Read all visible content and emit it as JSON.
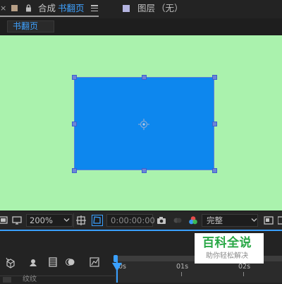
{
  "header": {
    "close_glyph": "×",
    "comp_prefix": "合成",
    "comp_name": "书翻页",
    "menu_glyph": "≡",
    "layer_panel_label": "图层",
    "layer_panel_value": "（无）"
  },
  "comp_tab": {
    "label": "书翻页"
  },
  "viewer": {
    "background_color": "#aaf2ad",
    "layer_color": "#0d87ee"
  },
  "viewer_toolbar": {
    "zoom": "200%",
    "timecode": "0:00:00:00",
    "resolution": "完整"
  },
  "timeline": {
    "ruler_labels": [
      "0s",
      "01s",
      "02s"
    ],
    "current_time_marker": "0s",
    "layer_row_label": "纹纹"
  },
  "watermark": {
    "title": "百科全说",
    "subtitle": "助你轻松解决"
  },
  "icons": [
    "close-icon",
    "lock-icon",
    "hamburger-icon",
    "camera-icon",
    "color-wheel-icon",
    "snap-icon",
    "mask-toggle-icon",
    "region-icon",
    "grid-icon",
    "display-icon",
    "chevron-down-icon"
  ]
}
